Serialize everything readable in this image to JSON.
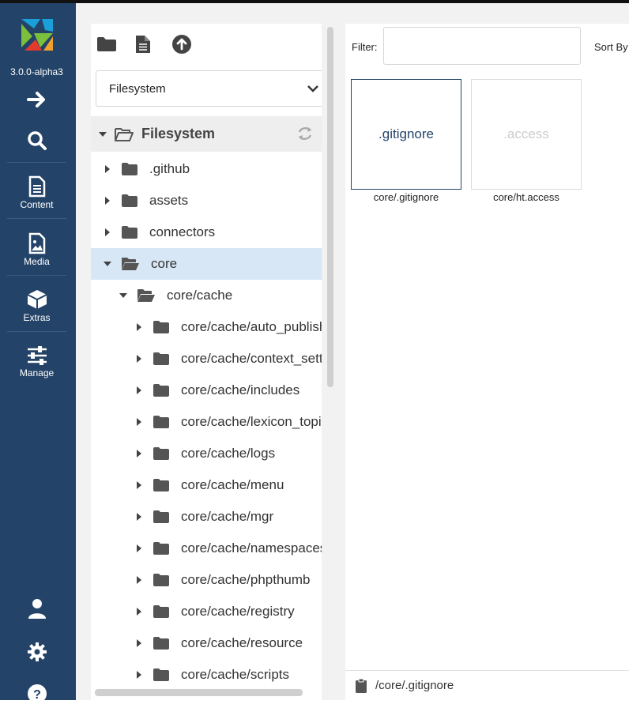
{
  "app": {
    "version": "3.0.0-alpha3",
    "brand_colors": [
      "#1a9fd8",
      "#7bbf3c",
      "#e33a2e",
      "#f0a12d"
    ]
  },
  "sidebar": {
    "top": [
      {
        "name": "arrow-right-icon"
      },
      {
        "name": "search-icon"
      }
    ],
    "menu": [
      {
        "label": "Content",
        "icon": "document-icon"
      },
      {
        "label": "Media",
        "icon": "image-icon"
      },
      {
        "label": "Extras",
        "icon": "box-icon"
      },
      {
        "label": "Manage",
        "icon": "sliders-icon"
      }
    ],
    "bottom": [
      {
        "name": "user-icon"
      },
      {
        "name": "gear-icon"
      },
      {
        "name": "help-icon"
      }
    ],
    "bg_color": "#234368"
  },
  "tree": {
    "toolbar": [
      "new-folder-icon",
      "new-file-icon",
      "upload-icon"
    ],
    "source_select": "Filesystem",
    "root_label": "Filesystem",
    "nodes": [
      {
        "label": ".github",
        "depth": 0,
        "open": false
      },
      {
        "label": "assets",
        "depth": 0,
        "open": false
      },
      {
        "label": "connectors",
        "depth": 0,
        "open": false
      },
      {
        "label": "core",
        "depth": 0,
        "open": true,
        "selected": true
      },
      {
        "label": "core/cache",
        "depth": 1,
        "open": true
      },
      {
        "label": "core/cache/auto_publish",
        "depth": 2,
        "open": false
      },
      {
        "label": "core/cache/context_settings",
        "depth": 2,
        "open": false
      },
      {
        "label": "core/cache/includes",
        "depth": 2,
        "open": false
      },
      {
        "label": "core/cache/lexicon_topics",
        "depth": 2,
        "open": false
      },
      {
        "label": "core/cache/logs",
        "depth": 2,
        "open": false
      },
      {
        "label": "core/cache/menu",
        "depth": 2,
        "open": false
      },
      {
        "label": "core/cache/mgr",
        "depth": 2,
        "open": false
      },
      {
        "label": "core/cache/namespaces",
        "depth": 2,
        "open": false
      },
      {
        "label": "core/cache/phpthumb",
        "depth": 2,
        "open": false
      },
      {
        "label": "core/cache/registry",
        "depth": 2,
        "open": false
      },
      {
        "label": "core/cache/resource",
        "depth": 2,
        "open": false
      },
      {
        "label": "core/cache/scripts",
        "depth": 2,
        "open": false
      }
    ],
    "selected_bg": "#d7e7f6"
  },
  "browser": {
    "filter_label": "Filter:",
    "filter_value": "",
    "sort_label": "Sort By",
    "files": [
      {
        "thumb_text": ".gitignore",
        "caption": "core/.gitignore",
        "selected": true
      },
      {
        "thumb_text": ".access",
        "caption": "core/ht.access",
        "selected": false
      }
    ],
    "status_path": "/core/.gitignore"
  }
}
